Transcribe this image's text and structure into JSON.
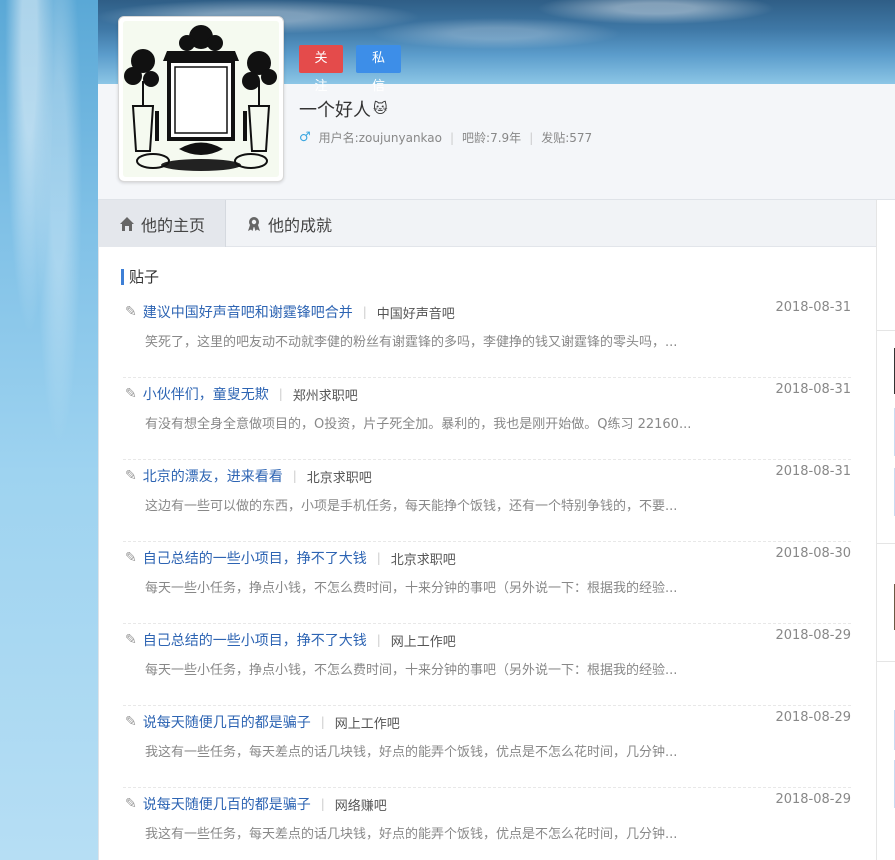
{
  "header": {
    "follow_label": "关注",
    "message_label": "私信",
    "username": "一个好人",
    "username_emoji": "🐱",
    "meta": {
      "username_label": "用户名:zoujunyankao",
      "age_label": "吧龄:7.9年",
      "posts_label": "发贴:577"
    }
  },
  "tabs": [
    {
      "label": "他的主页",
      "icon": "home-icon"
    },
    {
      "label": "他的成就",
      "icon": "achievement-icon"
    }
  ],
  "section": {
    "title": "贴子"
  },
  "posts": [
    {
      "title": "建议中国好声音吧和谢霆锋吧合并",
      "forum": "中国好声音吧",
      "date": "2018-08-31",
      "excerpt": "笑死了，这里的吧友动不动就李健的粉丝有谢霆锋的多吗，李健挣的钱又谢霆锋的零头吗，..."
    },
    {
      "title": "小伙伴们，童叟无欺",
      "forum": "郑州求职吧",
      "date": "2018-08-31",
      "excerpt": "有没有想全身全意做项目的，O投资，片子死全加。暴利的，我也是刚开始做。Q练习 22160..."
    },
    {
      "title": "北京的漂友，进来看看",
      "forum": "北京求职吧",
      "date": "2018-08-31",
      "excerpt": "这边有一些可以做的东西，小项是手机任务，每天能挣个饭钱，还有一个特别争钱的，不要..."
    },
    {
      "title": "自己总结的一些小项目，挣不了大钱",
      "forum": "北京求职吧",
      "date": "2018-08-30",
      "excerpt": "每天一些小任务，挣点小钱，不怎么费时间，十来分钟的事吧（另外说一下：根据我的经验..."
    },
    {
      "title": "自己总结的一些小项目，挣不了大钱",
      "forum": "网上工作吧",
      "date": "2018-08-29",
      "excerpt": "每天一些小任务，挣点小钱，不怎么费时间，十来分钟的事吧（另外说一下：根据我的经验..."
    },
    {
      "title": "说每天随便几百的都是骗子",
      "forum": "网上工作吧",
      "date": "2018-08-29",
      "excerpt": "我这有一些任务，每天差点的话几块钱，好点的能弄个饭钱，优点是不怎么花时间，几分钟..."
    },
    {
      "title": "说每天随便几百的都是骗子",
      "forum": "网络赚吧",
      "date": "2018-08-29",
      "excerpt": "我这有一些任务，每天差点的话几块钱，好点的能弄个饭钱，优点是不怎么花时间，几分钟..."
    }
  ],
  "colors": {
    "accent": "#3d7fd6",
    "follow": "#e44b4b",
    "message": "#3d8ee8",
    "link": "#2d64b3"
  }
}
